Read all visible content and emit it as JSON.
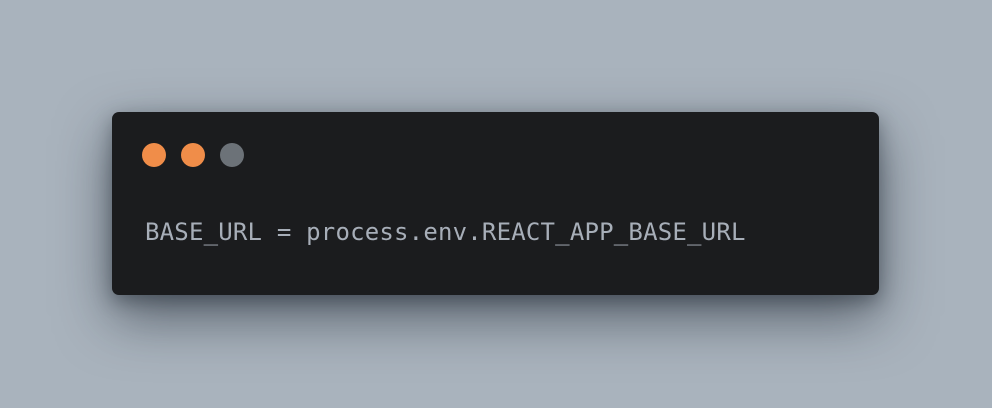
{
  "colors": {
    "background": "#a9b3bd",
    "window": "#1b1c1e",
    "code_text": "#a7aeb8",
    "dot_close": "#f08d49",
    "dot_minimize": "#f08d49",
    "dot_maximize": "#6c7278"
  },
  "window_controls": [
    {
      "icon": "close-dot-icon",
      "color": "#f08d49"
    },
    {
      "icon": "minimize-dot-icon",
      "color": "#f08d49"
    },
    {
      "icon": "maximize-dot-icon",
      "color": "#6c7278"
    }
  ],
  "code": {
    "line_1": "BASE_URL = process.env.REACT_APP_BASE_URL"
  }
}
